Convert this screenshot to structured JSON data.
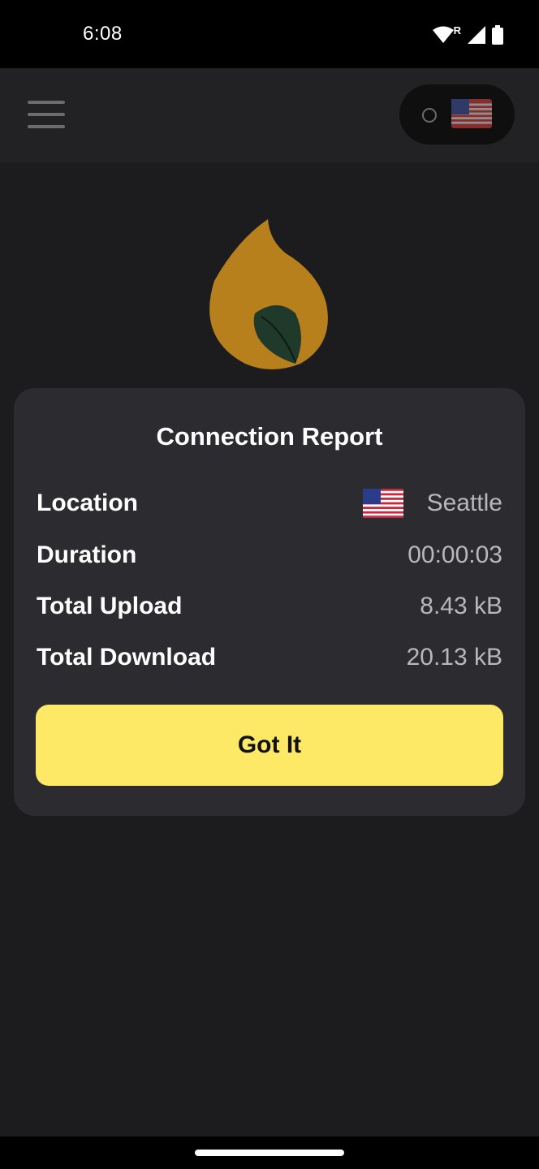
{
  "status_bar": {
    "time": "6:08",
    "roaming_indicator": "R",
    "icons": [
      "wifi-icon",
      "cellular-signal-icon",
      "battery-icon"
    ]
  },
  "header": {
    "menu_icon": "hamburger-menu-icon",
    "server_flag": "us-flag-icon"
  },
  "logo": {
    "icon": "flame-leaf-logo-icon"
  },
  "dialog": {
    "title": "Connection Report",
    "rows": [
      {
        "label": "Location",
        "value": "Seattle",
        "flag": "us-flag-icon"
      },
      {
        "label": "Duration",
        "value": "00:00:03"
      },
      {
        "label": "Total Upload",
        "value": "8.43 kB"
      },
      {
        "label": "Total Download",
        "value": "20.13 kB"
      }
    ],
    "button_label": "Got It"
  },
  "colors": {
    "accent": "#fde965",
    "dialog_bg": "#2c2c30",
    "app_bg": "#1c1c1e",
    "logo_orange": "#b8801c"
  }
}
